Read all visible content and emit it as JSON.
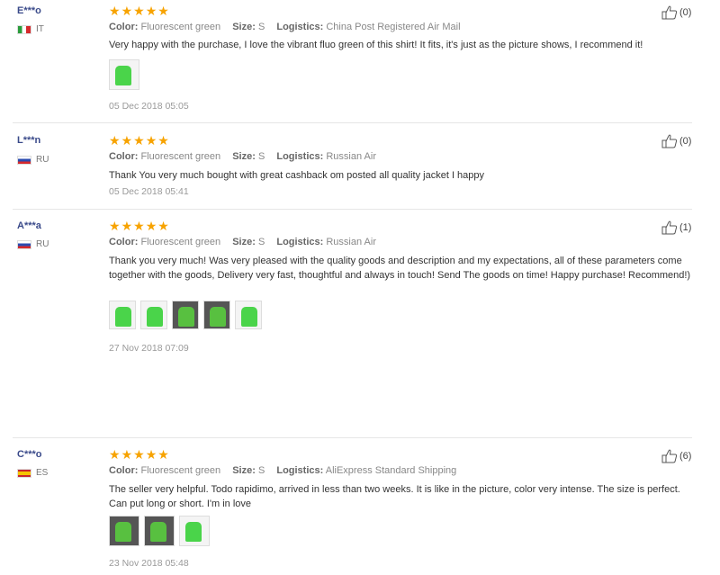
{
  "reviews": [
    {
      "user": "E***o",
      "country": "IT",
      "color_label": "Color:",
      "color": "Fluorescent green",
      "size_label": "Size:",
      "size": "S",
      "logistics_label": "Logistics:",
      "logistics": "China Post Registered Air Mail",
      "text": "Very happy with the purchase, I love the vibrant fluo green of this shirt! It fits, it's just as the picture shows, I recommend it!",
      "date": "05 Dec 2018 05:05",
      "helpful": "(0)",
      "rating": 5
    },
    {
      "user": "L***n",
      "country": "RU",
      "color_label": "Color:",
      "color": "Fluorescent green",
      "size_label": "Size:",
      "size": "S",
      "logistics_label": "Logistics:",
      "logistics": "Russian Air",
      "text": "Thank You very much bought with great cashback om posted all quality jacket I happy",
      "date": "05 Dec 2018 05:41",
      "helpful": "(0)",
      "rating": 5
    },
    {
      "user": "A***a",
      "country": "RU",
      "color_label": "Color:",
      "color": "Fluorescent green",
      "size_label": "Size:",
      "size": "S",
      "logistics_label": "Logistics:",
      "logistics": "Russian Air",
      "text": "Thank you very much! Was very pleased with the quality goods and description and my expectations, all of these parameters come together with the goods, Delivery very fast, thoughtful and always in touch! Send The goods on time! Happy purchase! Recommend!)",
      "date": "27 Nov 2018 07:09",
      "helpful": "(1)",
      "rating": 5
    },
    {
      "user": "C***o",
      "country": "ES",
      "color_label": "Color:",
      "color": "Fluorescent green",
      "size_label": "Size:",
      "size": "S",
      "logistics_label": "Logistics:",
      "logistics": "AliExpress Standard Shipping",
      "text": "The seller very helpful. Todo rapidimo, arrived in less than two weeks. It is like in the picture, color very intense. The size is perfect. Can put long or short. I'm in love",
      "date": "23 Nov 2018 05:48",
      "helpful": "(6)",
      "rating": 5
    }
  ],
  "icons": {
    "star": "star-icon",
    "helpful": "thumbs-up-icon",
    "flag": "flag-icon"
  },
  "colors": {
    "star": "#f7a300",
    "username": "#3a4a8a",
    "shirt": "#4ad44a"
  }
}
